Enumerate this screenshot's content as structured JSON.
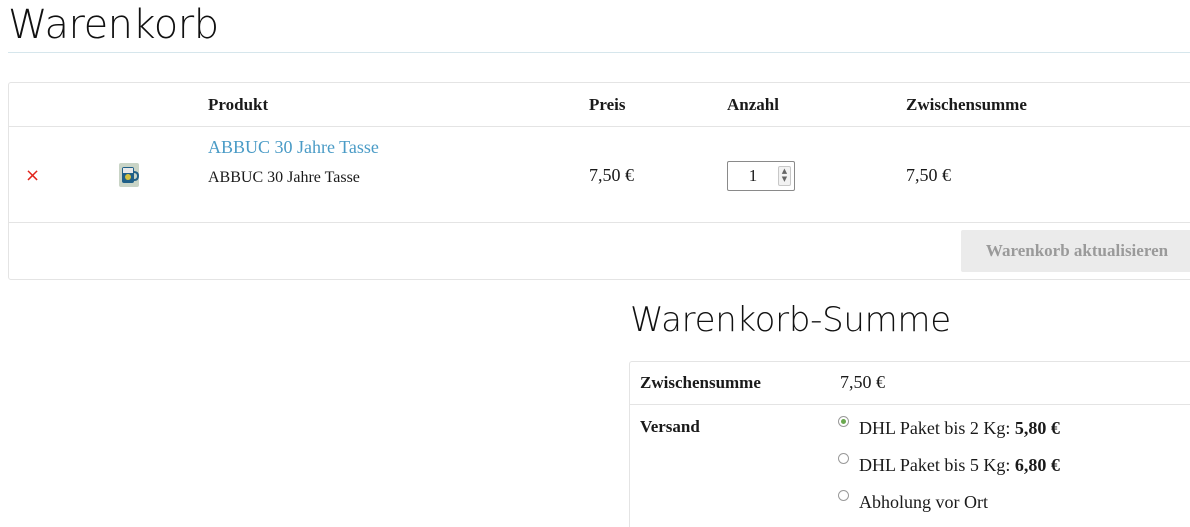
{
  "page": {
    "title": "Warenkorb"
  },
  "cart": {
    "columns": {
      "product": "Produkt",
      "price": "Preis",
      "quantity": "Anzahl",
      "subtotal": "Zwischensumme"
    },
    "items": [
      {
        "remove_icon": "×",
        "thumbnail_icon": "mug-thumbnail",
        "product_link": "ABBUC 30 Jahre Tasse",
        "product_meta": "ABBUC 30 Jahre Tasse",
        "price": "7,50 €",
        "quantity": "1",
        "subtotal": "7,50 €"
      }
    ],
    "update_button": "Warenkorb aktualisieren"
  },
  "totals": {
    "title": "Warenkorb-Summe",
    "subtotal_label": "Zwischensumme",
    "subtotal_value": "7,50 €",
    "shipping_label": "Versand",
    "shipping_options": [
      {
        "label": "DHL Paket bis 2 Kg:",
        "price": "5,80 €",
        "selected": true
      },
      {
        "label": "DHL Paket bis 5 Kg:",
        "price": "6,80 €",
        "selected": false
      },
      {
        "label": "Abholung vor Ort",
        "price": "",
        "selected": false
      }
    ]
  },
  "colors": {
    "link": "#4a9bc6",
    "remove": "#e2241b",
    "radio_selected": "#6aa84f",
    "button_bg": "#ebebeb",
    "button_text": "#9a9a9a"
  }
}
